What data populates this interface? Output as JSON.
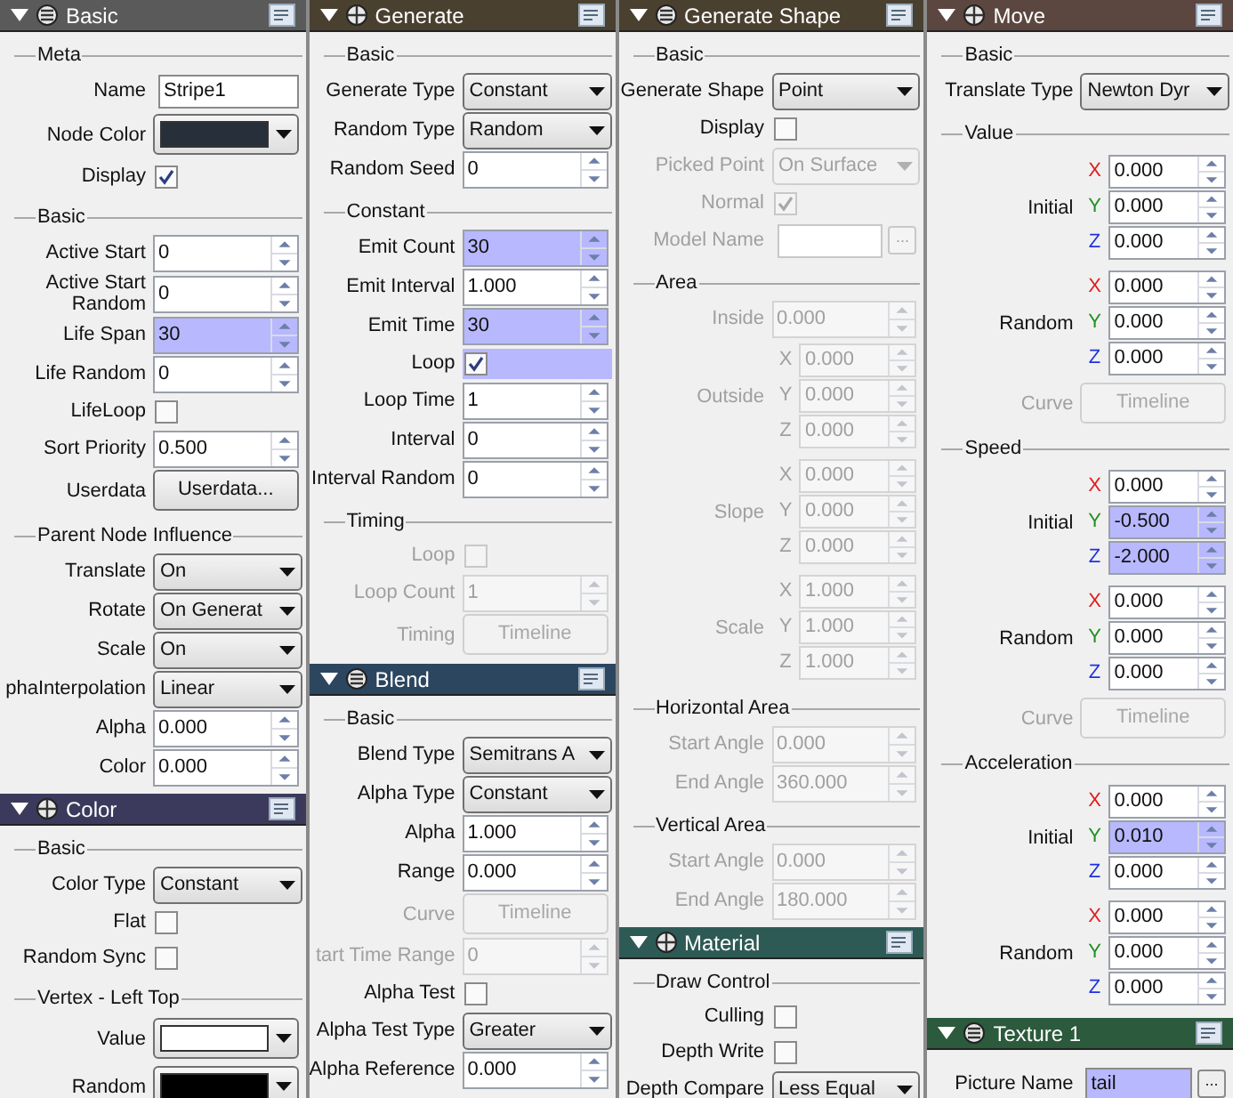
{
  "columns": [
    {
      "panels": [
        {
          "title": "Basic",
          "color": "#5a5a5a",
          "groups": [
            {
              "title": "Meta",
              "rows": [
                {
                  "kind": "text",
                  "label": "Name",
                  "value": "Stripe1",
                  "disabled": false,
                  "highlighted": false
                },
                {
                  "kind": "color",
                  "label": "Node Color",
                  "color": "#27303a",
                  "disabled": false
                },
                {
                  "kind": "check",
                  "label": "Display",
                  "checked": true,
                  "disabled": false,
                  "highlighted": false
                }
              ]
            },
            {
              "title": "Basic",
              "rows": [
                {
                  "kind": "spin",
                  "label": "Active Start",
                  "value": "0",
                  "disabled": false,
                  "highlighted": false
                },
                {
                  "kind": "spin",
                  "label": "Active Start Random",
                  "value": "0",
                  "disabled": false,
                  "highlighted": false
                },
                {
                  "kind": "spin",
                  "label": "Life Span",
                  "value": "30",
                  "disabled": false,
                  "highlighted": true
                },
                {
                  "kind": "spin",
                  "label": "Life Random",
                  "value": "0",
                  "disabled": false,
                  "highlighted": false
                },
                {
                  "kind": "check",
                  "label": "LifeLoop",
                  "checked": false,
                  "disabled": false,
                  "highlighted": false
                },
                {
                  "kind": "spin",
                  "label": "Sort Priority",
                  "value": "0.500",
                  "disabled": false,
                  "highlighted": false
                },
                {
                  "kind": "button",
                  "label": "Userdata",
                  "value": "Userdata...",
                  "disabled": false
                }
              ]
            },
            {
              "title": "Parent Node Influence",
              "rows": [
                {
                  "kind": "select",
                  "label": "Translate",
                  "value": "On",
                  "disabled": false
                },
                {
                  "kind": "select",
                  "label": "Rotate",
                  "value": "On Generat",
                  "disabled": false
                },
                {
                  "kind": "select",
                  "label": "Scale",
                  "value": "On",
                  "disabled": false
                },
                {
                  "kind": "select",
                  "label": "phaInterpolation",
                  "value": "Linear",
                  "disabled": false
                },
                {
                  "kind": "spin",
                  "label": "Alpha",
                  "value": "0.000",
                  "disabled": false,
                  "highlighted": false
                },
                {
                  "kind": "spin",
                  "label": "Color",
                  "value": "0.000",
                  "disabled": false,
                  "highlighted": false
                }
              ]
            }
          ]
        },
        {
          "title": "Color",
          "color": "#3c3a5c",
          "groups": [
            {
              "title": "Basic",
              "rows": [
                {
                  "kind": "select",
                  "label": "Color Type",
                  "value": "Constant",
                  "disabled": false
                },
                {
                  "kind": "check",
                  "label": "Flat",
                  "checked": false,
                  "disabled": false,
                  "highlighted": false
                },
                {
                  "kind": "check",
                  "label": "Random Sync",
                  "checked": false,
                  "disabled": false,
                  "highlighted": false
                }
              ]
            },
            {
              "title": "Vertex - Left Top",
              "rows": [
                {
                  "kind": "color",
                  "label": "Value",
                  "color": "#ffffff",
                  "disabled": false
                },
                {
                  "kind": "color",
                  "label": "Random",
                  "color": "#000000",
                  "disabled": false
                }
              ]
            }
          ]
        }
      ]
    },
    {
      "panels": [
        {
          "title": "Generate",
          "color": "#4a4030",
          "groups": [
            {
              "title": "Basic",
              "rows": [
                {
                  "kind": "select",
                  "label": "Generate Type",
                  "value": "Constant",
                  "disabled": false
                },
                {
                  "kind": "select",
                  "label": "Random Type",
                  "value": "Random",
                  "disabled": false
                },
                {
                  "kind": "spin",
                  "label": "Random Seed",
                  "value": "0",
                  "disabled": false,
                  "highlighted": false
                }
              ]
            },
            {
              "title": "Constant",
              "rows": [
                {
                  "kind": "spin",
                  "label": "Emit Count",
                  "value": "30",
                  "disabled": false,
                  "highlighted": true
                },
                {
                  "kind": "spin",
                  "label": "Emit Interval",
                  "value": "1.000",
                  "disabled": false,
                  "highlighted": false
                },
                {
                  "kind": "spin",
                  "label": "Emit Time",
                  "value": "30",
                  "disabled": false,
                  "highlighted": true
                },
                {
                  "kind": "check",
                  "label": "Loop",
                  "checked": true,
                  "disabled": false,
                  "highlighted": true
                },
                {
                  "kind": "spin",
                  "label": "Loop Time",
                  "value": "1",
                  "disabled": false,
                  "highlighted": false
                },
                {
                  "kind": "spin",
                  "label": "Interval",
                  "value": "0",
                  "disabled": false,
                  "highlighted": false
                },
                {
                  "kind": "spin",
                  "label": "Interval Random",
                  "value": "0",
                  "disabled": false,
                  "highlighted": false
                }
              ]
            },
            {
              "title": "Timing",
              "rows": [
                {
                  "kind": "check",
                  "label": "Loop",
                  "checked": false,
                  "disabled": true,
                  "highlighted": false
                },
                {
                  "kind": "spin",
                  "label": "Loop Count",
                  "value": "1",
                  "disabled": true,
                  "highlighted": false
                },
                {
                  "kind": "button",
                  "label": "Timing",
                  "value": "Timeline",
                  "disabled": true
                }
              ]
            }
          ]
        },
        {
          "title": "Blend",
          "color": "#2c4660",
          "groups": [
            {
              "title": "Basic",
              "rows": [
                {
                  "kind": "select",
                  "label": "Blend Type",
                  "value": "Semitrans A",
                  "disabled": false
                },
                {
                  "kind": "select",
                  "label": "Alpha Type",
                  "value": "Constant",
                  "disabled": false
                },
                {
                  "kind": "spin",
                  "label": "Alpha",
                  "value": "1.000",
                  "disabled": false,
                  "highlighted": false
                },
                {
                  "kind": "spin",
                  "label": "Range",
                  "value": "0.000",
                  "disabled": false,
                  "highlighted": false
                },
                {
                  "kind": "button",
                  "label": "Curve",
                  "value": "Timeline",
                  "disabled": true
                },
                {
                  "kind": "spin",
                  "label": "tart Time Range",
                  "value": "0",
                  "disabled": true,
                  "highlighted": false
                },
                {
                  "kind": "check",
                  "label": "Alpha Test",
                  "checked": false,
                  "disabled": false,
                  "highlighted": false
                },
                {
                  "kind": "select",
                  "label": "Alpha Test Type",
                  "value": "Greater",
                  "disabled": false
                },
                {
                  "kind": "spin",
                  "label": "Alpha Reference",
                  "value": "0.000",
                  "disabled": false,
                  "highlighted": false
                }
              ]
            }
          ]
        }
      ]
    },
    {
      "panels": [
        {
          "title": "Generate Shape",
          "color": "#4a4030",
          "groups": [
            {
              "title": "Basic",
              "rows": [
                {
                  "kind": "select",
                  "label": "Generate Shape",
                  "value": "Point",
                  "disabled": false
                },
                {
                  "kind": "check",
                  "label": "Display",
                  "checked": false,
                  "disabled": false,
                  "highlighted": false
                },
                {
                  "kind": "select",
                  "label": "Picked Point",
                  "value": "On Surface",
                  "disabled": true
                },
                {
                  "kind": "check",
                  "label": "Normal",
                  "checked": true,
                  "disabled": true,
                  "highlighted": false
                },
                {
                  "kind": "file",
                  "label": "Model Name",
                  "button": "...",
                  "disabled": true,
                  "highlighted": false
                }
              ]
            },
            {
              "title": "Area",
              "rows": [
                {
                  "kind": "spin",
                  "label": "Inside",
                  "value": "0.000",
                  "disabled": true,
                  "highlighted": false
                },
                {
                  "kind": "vec",
                  "label": "Outside",
                  "disabled": true,
                  "axes": [
                    {
                      "axis": "X",
                      "value": "0.000",
                      "highlighted": false
                    },
                    {
                      "axis": "Y",
                      "value": "0.000",
                      "highlighted": false
                    },
                    {
                      "axis": "Z",
                      "value": "0.000",
                      "highlighted": false
                    }
                  ]
                },
                {
                  "kind": "vec",
                  "label": "Slope",
                  "disabled": true,
                  "axes": [
                    {
                      "axis": "X",
                      "value": "0.000",
                      "highlighted": false
                    },
                    {
                      "axis": "Y",
                      "value": "0.000",
                      "highlighted": false
                    },
                    {
                      "axis": "Z",
                      "value": "0.000",
                      "highlighted": false
                    }
                  ]
                },
                {
                  "kind": "vec",
                  "label": "Scale",
                  "disabled": true,
                  "axes": [
                    {
                      "axis": "X",
                      "value": "1.000",
                      "highlighted": false
                    },
                    {
                      "axis": "Y",
                      "value": "1.000",
                      "highlighted": false
                    },
                    {
                      "axis": "Z",
                      "value": "1.000",
                      "highlighted": false
                    }
                  ]
                }
              ]
            },
            {
              "title": "Horizontal Area",
              "rows": [
                {
                  "kind": "spin",
                  "label": "Start Angle",
                  "value": "0.000",
                  "disabled": true,
                  "highlighted": false
                },
                {
                  "kind": "spin",
                  "label": "End Angle",
                  "value": "360.000",
                  "disabled": true,
                  "highlighted": false
                }
              ]
            },
            {
              "title": "Vertical Area",
              "rows": [
                {
                  "kind": "spin",
                  "label": "Start Angle",
                  "value": "0.000",
                  "disabled": true,
                  "highlighted": false
                },
                {
                  "kind": "spin",
                  "label": "End Angle",
                  "value": "180.000",
                  "disabled": true,
                  "highlighted": false
                }
              ]
            }
          ]
        },
        {
          "title": "Material",
          "color": "#2e5a56",
          "groups": [
            {
              "title": "Draw Control",
              "rows": [
                {
                  "kind": "check",
                  "label": "Culling",
                  "checked": false,
                  "disabled": false,
                  "highlighted": false
                },
                {
                  "kind": "check",
                  "label": "Depth Write",
                  "checked": false,
                  "disabled": false,
                  "highlighted": false
                },
                {
                  "kind": "select",
                  "label": "Depth Compare",
                  "value": "Less Equal",
                  "disabled": false
                }
              ]
            }
          ]
        }
      ]
    },
    {
      "panels": [
        {
          "title": "Move",
          "color": "#5c4640",
          "groups": [
            {
              "title": "Basic",
              "rows": [
                {
                  "kind": "select",
                  "label": "Translate Type",
                  "value": "Newton Dyr",
                  "disabled": false
                }
              ]
            },
            {
              "title": "Value",
              "rows": [
                {
                  "kind": "vec",
                  "label": "Initial",
                  "disabled": false,
                  "axes": [
                    {
                      "axis": "X",
                      "value": "0.000",
                      "highlighted": false
                    },
                    {
                      "axis": "Y",
                      "value": "0.000",
                      "highlighted": false
                    },
                    {
                      "axis": "Z",
                      "value": "0.000",
                      "highlighted": false
                    }
                  ]
                },
                {
                  "kind": "vec",
                  "label": "Random",
                  "disabled": false,
                  "axes": [
                    {
                      "axis": "X",
                      "value": "0.000",
                      "highlighted": false
                    },
                    {
                      "axis": "Y",
                      "value": "0.000",
                      "highlighted": false
                    },
                    {
                      "axis": "Z",
                      "value": "0.000",
                      "highlighted": false
                    }
                  ]
                },
                {
                  "kind": "button",
                  "label": "Curve",
                  "value": "Timeline",
                  "disabled": true
                }
              ]
            },
            {
              "title": "Speed",
              "rows": [
                {
                  "kind": "vec",
                  "label": "Initial",
                  "disabled": false,
                  "axes": [
                    {
                      "axis": "X",
                      "value": "0.000",
                      "highlighted": false
                    },
                    {
                      "axis": "Y",
                      "value": "-0.500",
                      "highlighted": true
                    },
                    {
                      "axis": "Z",
                      "value": "-2.000",
                      "highlighted": true
                    }
                  ]
                },
                {
                  "kind": "vec",
                  "label": "Random",
                  "disabled": false,
                  "axes": [
                    {
                      "axis": "X",
                      "value": "0.000",
                      "highlighted": false
                    },
                    {
                      "axis": "Y",
                      "value": "0.000",
                      "highlighted": false
                    },
                    {
                      "axis": "Z",
                      "value": "0.000",
                      "highlighted": false
                    }
                  ]
                },
                {
                  "kind": "button",
                  "label": "Curve",
                  "value": "Timeline",
                  "disabled": true
                }
              ]
            },
            {
              "title": "Acceleration",
              "rows": [
                {
                  "kind": "vec",
                  "label": "Initial",
                  "disabled": false,
                  "axes": [
                    {
                      "axis": "X",
                      "value": "0.000",
                      "highlighted": false
                    },
                    {
                      "axis": "Y",
                      "value": "0.010",
                      "highlighted": true
                    },
                    {
                      "axis": "Z",
                      "value": "0.000",
                      "highlighted": false
                    }
                  ]
                },
                {
                  "kind": "vec",
                  "label": "Random",
                  "disabled": false,
                  "axes": [
                    {
                      "axis": "X",
                      "value": "0.000",
                      "highlighted": false
                    },
                    {
                      "axis": "Y",
                      "value": "0.000",
                      "highlighted": false
                    },
                    {
                      "axis": "Z",
                      "value": "0.000",
                      "highlighted": false
                    }
                  ]
                }
              ]
            }
          ]
        },
        {
          "title": "Texture 1",
          "color": "#2c5a3c",
          "groups": [
            {
              "rows": [
                {
                  "kind": "file",
                  "label": "Picture Name",
                  "value": "tail",
                  "button": "...",
                  "disabled": false,
                  "highlighted": true
                }
              ]
            }
          ]
        }
      ]
    }
  ]
}
